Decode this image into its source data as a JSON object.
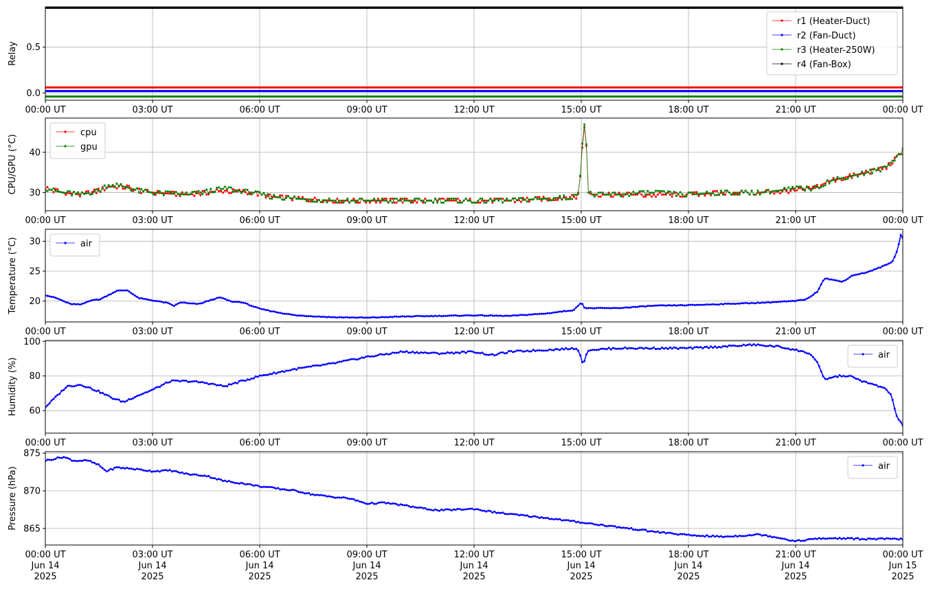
{
  "colors": {
    "r1": "#ff0000",
    "r2": "#0000ff",
    "r3": "#008000",
    "r4": "#000000",
    "cpu": "#ff0000",
    "gpu": "#008000",
    "air": "#0000ff",
    "grid": "#b0b0b0"
  },
  "chart_data": [
    {
      "type": "line",
      "ylabel": "Relay",
      "ylim": [
        -0.08,
        0.94
      ],
      "yticks": [
        0.0,
        0.5
      ],
      "yticklabels": [
        "0.0",
        "0.5"
      ],
      "x_ticks": [
        "00:00 UT",
        "03:00 UT",
        "06:00 UT",
        "09:00 UT",
        "12:00 UT",
        "15:00 UT",
        "18:00 UT",
        "21:00 UT",
        "00:00 UT"
      ],
      "x_range_hours": [
        0,
        24
      ],
      "grid": true,
      "legend": "top-right",
      "series": [
        {
          "name": "r1 (Heater-Duct)",
          "color_key": "r1",
          "x_hours": [
            0,
            24
          ],
          "y": [
            0.06,
            0.06
          ]
        },
        {
          "name": "r2 (Fan-Duct)",
          "color_key": "r2",
          "x_hours": [
            0,
            24
          ],
          "y": [
            0.02,
            0.02
          ]
        },
        {
          "name": "r3 (Heater-250W)",
          "color_key": "r3",
          "x_hours": [
            0,
            24
          ],
          "y": [
            -0.04,
            -0.04
          ]
        },
        {
          "name": "r4 (Fan-Box)",
          "color_key": "r4",
          "x_hours": [
            0,
            24
          ],
          "y": [
            0.93,
            0.93
          ]
        }
      ]
    },
    {
      "type": "line",
      "ylabel": "CPU/GPU (°C)",
      "ylim": [
        25.5,
        48.5
      ],
      "yticks": [
        30,
        40
      ],
      "yticklabels": [
        "30",
        "40"
      ],
      "x_ticks": [
        "00:00 UT",
        "03:00 UT",
        "06:00 UT",
        "09:00 UT",
        "12:00 UT",
        "15:00 UT",
        "18:00 UT",
        "21:00 UT",
        "00:00 UT"
      ],
      "x_range_hours": [
        0,
        24
      ],
      "grid": true,
      "legend": "top-left",
      "series": [
        {
          "name": "cpu",
          "color_key": "cpu",
          "x_hours": [
            0,
            0.5,
            1.0,
            1.5,
            1.8,
            2.2,
            2.6,
            3.0,
            4.0,
            5.0,
            5.8,
            6.3,
            7.0,
            8.0,
            9.0,
            10.0,
            11.0,
            12.0,
            13.0,
            14.0,
            14.9,
            15.0,
            15.05,
            15.1,
            15.15,
            15.2,
            15.3,
            16.0,
            17.0,
            18.0,
            19.0,
            20.0,
            21.0,
            21.5,
            22.0,
            22.5,
            23.0,
            23.5,
            24.0
          ],
          "y": [
            31,
            30,
            29.5,
            30.5,
            31.5,
            31.5,
            30.5,
            30,
            29.5,
            30.5,
            30,
            29,
            28.5,
            28,
            28,
            28,
            28,
            28,
            28,
            28.5,
            29,
            36,
            45,
            47.5,
            40,
            30,
            29.5,
            29.5,
            29.5,
            29.5,
            30,
            30,
            30.5,
            31,
            33,
            34,
            35,
            36,
            40
          ]
        },
        {
          "name": "gpu",
          "color_key": "gpu",
          "x_hours": [
            0,
            0.5,
            1.0,
            1.5,
            1.8,
            2.2,
            2.6,
            3.0,
            4.0,
            5.0,
            5.8,
            6.3,
            7.0,
            8.0,
            9.0,
            10.0,
            11.0,
            12.0,
            13.0,
            14.0,
            14.9,
            15.0,
            15.05,
            15.1,
            15.15,
            15.2,
            15.3,
            16.0,
            17.0,
            18.0,
            19.0,
            20.0,
            21.0,
            21.5,
            22.0,
            22.5,
            23.0,
            23.5,
            24.0
          ],
          "y": [
            31,
            30,
            29.5,
            30.5,
            32,
            31.5,
            30.5,
            30,
            29.5,
            31,
            30,
            29,
            28.5,
            28,
            28,
            28,
            28,
            28,
            28,
            28.5,
            29,
            37,
            46,
            48,
            41,
            30,
            29.5,
            29.5,
            30,
            29.5,
            30,
            30,
            31,
            31,
            33,
            34,
            35,
            36,
            40.5
          ]
        }
      ]
    },
    {
      "type": "line",
      "ylabel": "Temperature (°C)",
      "ylim": [
        16.5,
        32
      ],
      "yticks": [
        20,
        25,
        30
      ],
      "yticklabels": [
        "20",
        "25",
        "30"
      ],
      "x_ticks": [
        "00:00 UT",
        "03:00 UT",
        "06:00 UT",
        "09:00 UT",
        "12:00 UT",
        "15:00 UT",
        "18:00 UT",
        "21:00 UT",
        "00:00 UT"
      ],
      "x_range_hours": [
        0,
        24
      ],
      "grid": true,
      "legend": "top-left",
      "series": [
        {
          "name": "air",
          "color_key": "air",
          "x_hours": [
            0,
            0.3,
            0.7,
            1.0,
            1.3,
            1.5,
            2.0,
            2.3,
            2.6,
            3.0,
            3.4,
            3.6,
            3.8,
            4.0,
            4.3,
            4.7,
            4.9,
            5.2,
            5.5,
            6.0,
            6.5,
            7.0,
            8.0,
            9.0,
            10.0,
            11.0,
            12.0,
            13.0,
            14.0,
            14.8,
            15.0,
            15.1,
            15.2,
            16.0,
            17.0,
            18.0,
            19.0,
            20.0,
            21.0,
            21.3,
            21.6,
            21.8,
            22.0,
            22.3,
            22.6,
            23.0,
            23.4,
            23.7,
            23.85,
            23.95,
            24.0
          ],
          "y": [
            21,
            20.5,
            19.5,
            19.4,
            20.2,
            20.2,
            21.7,
            21.8,
            20.5,
            20.1,
            19.7,
            19.2,
            19.8,
            19.6,
            19.5,
            20.3,
            20.6,
            19.9,
            19.8,
            18.7,
            18.1,
            17.6,
            17.3,
            17.2,
            17.4,
            17.5,
            17.6,
            17.5,
            17.9,
            18.5,
            19.8,
            18.8,
            18.8,
            18.8,
            19.2,
            19.3,
            19.5,
            19.7,
            20.0,
            20.3,
            21.5,
            23.8,
            23.6,
            23.2,
            24.3,
            24.8,
            25.7,
            26.5,
            28.5,
            31.3,
            30.5
          ]
        }
      ]
    },
    {
      "type": "line",
      "ylabel": "Humidity (%)",
      "ylim": [
        47,
        100.5
      ],
      "yticks": [
        60,
        80,
        100
      ],
      "yticklabels": [
        "60",
        "80",
        "100"
      ],
      "x_ticks": [
        "00:00 UT",
        "03:00 UT",
        "06:00 UT",
        "09:00 UT",
        "12:00 UT",
        "15:00 UT",
        "18:00 UT",
        "21:00 UT",
        "00:00 UT"
      ],
      "x_range_hours": [
        0,
        24
      ],
      "grid": true,
      "legend": "top-right",
      "series": [
        {
          "name": "air",
          "color_key": "air",
          "x_hours": [
            0,
            0.3,
            0.6,
            1.0,
            1.5,
            1.9,
            2.2,
            2.5,
            3.0,
            3.5,
            4.0,
            4.5,
            5.0,
            5.5,
            6.0,
            7.0,
            8.0,
            9.0,
            10.0,
            11.0,
            12.0,
            12.5,
            13.0,
            14.0,
            14.9,
            15.05,
            15.2,
            16.0,
            17.0,
            18.0,
            19.0,
            19.8,
            20.5,
            21.0,
            21.4,
            21.6,
            21.8,
            22.2,
            22.5,
            23.0,
            23.5,
            23.7,
            23.8,
            24.0
          ],
          "y": [
            62,
            68,
            74,
            75,
            71,
            67,
            65,
            68,
            72,
            77,
            77,
            76,
            74,
            77,
            80,
            84,
            87,
            91,
            94,
            93,
            94,
            92,
            94,
            95,
            96,
            87,
            95,
            96,
            96,
            96,
            97,
            98,
            97,
            95,
            93,
            88,
            78,
            80,
            80,
            76,
            73,
            68,
            58,
            51
          ]
        }
      ]
    },
    {
      "type": "line",
      "ylabel": "Pressure (hPa)",
      "ylim": [
        862.8,
        875.2
      ],
      "yticks": [
        865,
        870,
        875
      ],
      "yticklabels": [
        "865",
        "870",
        "875"
      ],
      "x_ticks": [
        "00:00 UT\nJun 14\n2025",
        "03:00 UT\nJun 14\n2025",
        "06:00 UT\nJun 14\n2025",
        "09:00 UT\nJun 14\n2025",
        "12:00 UT\nJun 14\n2025",
        "15:00 UT\nJun 14\n2025",
        "18:00 UT\nJun 14\n2025",
        "21:00 UT\nJun 14\n2025",
        "00:00 UT\nJun 15\n2025"
      ],
      "x_range_hours": [
        0,
        24
      ],
      "grid": true,
      "legend": "top-right",
      "series": [
        {
          "name": "air",
          "color_key": "air",
          "x_hours": [
            0,
            0.5,
            0.8,
            1.2,
            1.5,
            1.7,
            2.0,
            2.5,
            3.0,
            3.5,
            4.0,
            4.5,
            5.0,
            5.5,
            6.0,
            6.5,
            7.0,
            7.5,
            8.0,
            8.5,
            9.0,
            9.5,
            10.0,
            10.5,
            11.0,
            11.5,
            12.0,
            12.5,
            13.0,
            14.0,
            15.0,
            16.0,
            17.0,
            18.0,
            19.0,
            20.0,
            20.5,
            21.0,
            21.5,
            22.0,
            23.0,
            24.0
          ],
          "y": [
            874.0,
            874.5,
            874.0,
            874.0,
            873.4,
            872.6,
            873.1,
            872.9,
            872.6,
            872.7,
            872.2,
            872.0,
            871.3,
            871.0,
            870.6,
            870.3,
            870.0,
            869.5,
            869.2,
            869.0,
            868.3,
            868.4,
            868.1,
            867.7,
            867.4,
            867.5,
            867.6,
            867.2,
            866.9,
            866.4,
            865.8,
            865.2,
            864.6,
            864.1,
            863.9,
            864.2,
            863.8,
            863.3,
            863.6,
            863.7,
            863.6,
            863.6
          ]
        }
      ]
    }
  ]
}
